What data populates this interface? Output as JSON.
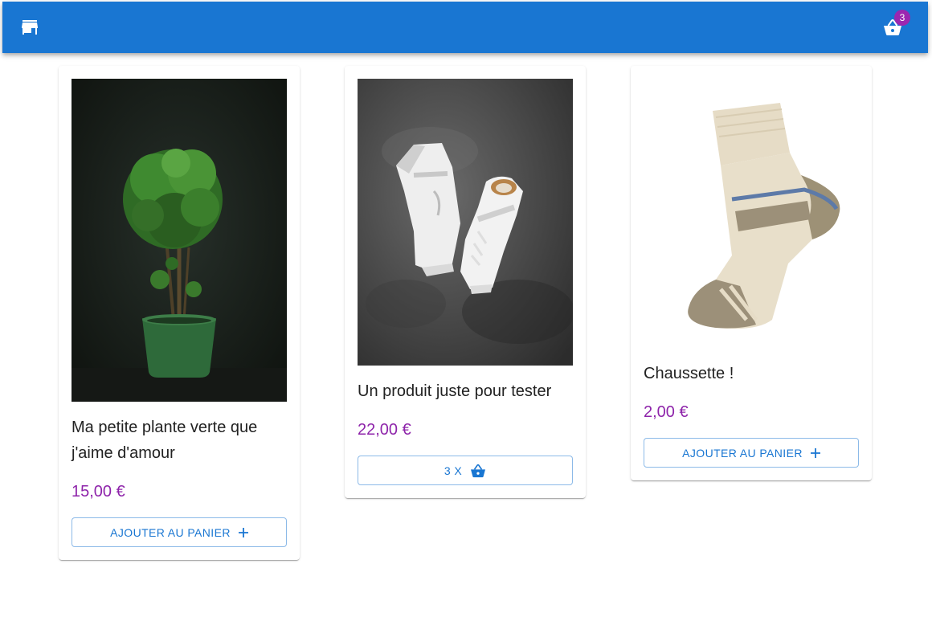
{
  "header": {
    "icons": {
      "store": "store-icon",
      "cart": "shopping-basket-icon"
    },
    "cart_count": "3",
    "colors": {
      "appbar": "#1976d2",
      "badge": "#9c27b0"
    }
  },
  "products": [
    {
      "title": "Ma petite plante verte que j'aime d'amour",
      "price": "15,00 €",
      "button_label": "AJOUTER AU PANIER",
      "button_icon": "plus-icon"
    },
    {
      "title": "Un produit juste pour tester",
      "price": "22,00 €",
      "button_label": "3 X",
      "button_icon": "shopping-basket-icon"
    },
    {
      "title": "Chaussette !",
      "price": "2,00 €",
      "button_label": "AJOUTER AU PANIER",
      "button_icon": "plus-icon"
    }
  ],
  "colors": {
    "price": "#8e24aa",
    "button": "#1976d2"
  }
}
